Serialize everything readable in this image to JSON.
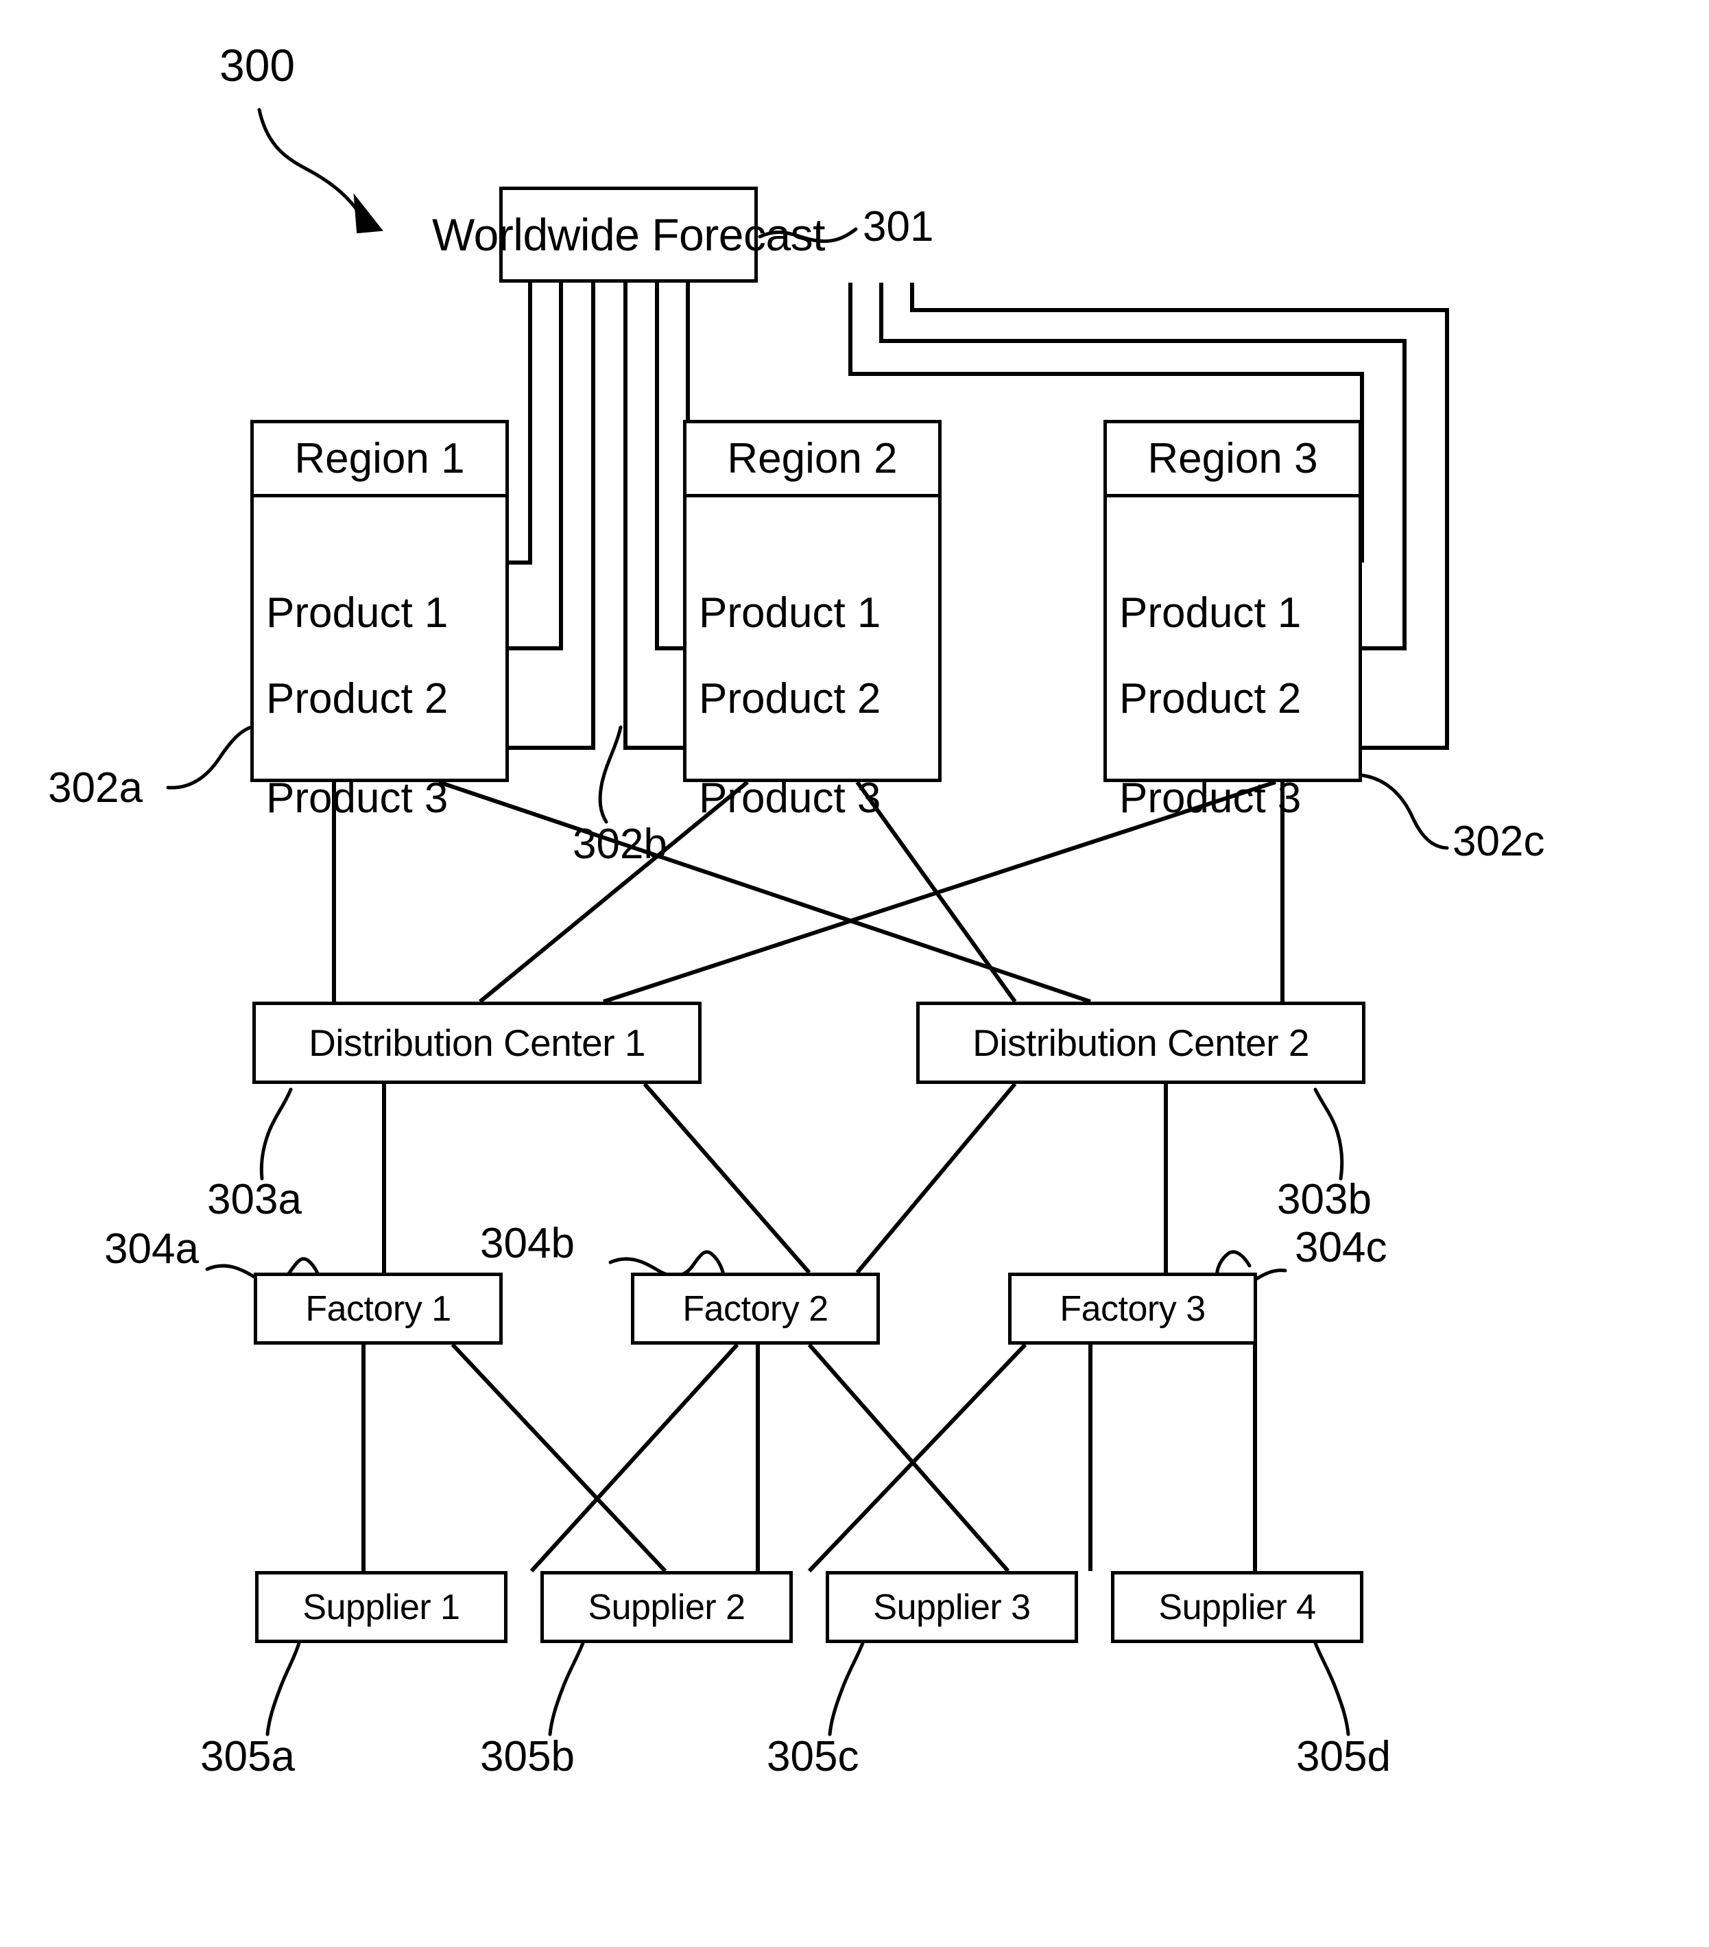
{
  "figure": {
    "ref_main": "300",
    "title_node": {
      "label": "Worldwide Forecast",
      "ref": "301"
    },
    "regions": [
      {
        "header": "Region 1",
        "ref": "302a",
        "products": [
          "Product 1",
          "Product 2",
          "Product 3"
        ]
      },
      {
        "header": "Region 2",
        "ref": "302b",
        "products": [
          "Product 1",
          "Product 2",
          "Product 3"
        ]
      },
      {
        "header": "Region 3",
        "ref": "302c",
        "products": [
          "Product 1",
          "Product 2",
          "Product 3"
        ]
      }
    ],
    "distribution_centers": [
      {
        "label": "Distribution Center 1",
        "ref": "303a"
      },
      {
        "label": "Distribution Center 2",
        "ref": "303b"
      }
    ],
    "factories": [
      {
        "label": "Factory 1",
        "ref": "304a"
      },
      {
        "label": "Factory 2",
        "ref": "304b"
      },
      {
        "label": "Factory 3",
        "ref": "304c"
      }
    ],
    "suppliers": [
      {
        "label": "Supplier 1",
        "ref": "305a"
      },
      {
        "label": "Supplier 2",
        "ref": "305b"
      },
      {
        "label": "Supplier 3",
        "ref": "305c"
      },
      {
        "label": "Supplier 4",
        "ref": "305d"
      }
    ],
    "colors": {
      "stroke": "#000000",
      "background": "#ffffff"
    }
  }
}
